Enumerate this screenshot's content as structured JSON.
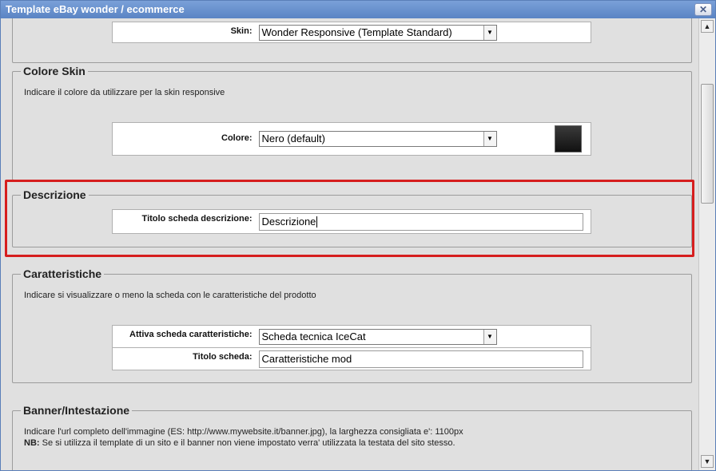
{
  "window": {
    "title": "Template eBay wonder / ecommerce",
    "close_glyph": "✕"
  },
  "skin_section": {
    "label": "Skin:",
    "value": "Wonder Responsive (Template Standard)"
  },
  "colore_skin": {
    "legend": "Colore Skin",
    "description": "Indicare il colore da utilizzare per la skin responsive",
    "label": "Colore:",
    "value": "Nero (default)",
    "swatch_color": "#222222"
  },
  "descrizione": {
    "legend": "Descrizione",
    "label": "Titolo scheda descrizione:",
    "value": "Descrizione"
  },
  "caratteristiche": {
    "legend": "Caratteristiche",
    "description": "Indicare si visualizzare o meno la scheda con le caratteristiche del prodotto",
    "attiva_label": "Attiva scheda caratteristiche:",
    "attiva_value": "Scheda tecnica IceCat",
    "titolo_label": "Titolo scheda:",
    "titolo_value": "Caratteristiche mod"
  },
  "banner": {
    "legend": "Banner/Intestazione",
    "description_line1": "Indicare l'url completo dell'immagine (ES: http://www.mywebsite.it/banner.jpg), la larghezza consigliata e': 1100px",
    "nb_label": "NB:",
    "description_line2": "Se si utilizza il template di un sito e il banner non viene impostato verra' utilizzata la testata del sito stesso."
  },
  "icons": {
    "dropdown": "▼",
    "scroll_up": "▲",
    "scroll_down": "▼"
  },
  "colors": {
    "highlight": "#d61e1e",
    "titlebar": "#5a84c4"
  }
}
